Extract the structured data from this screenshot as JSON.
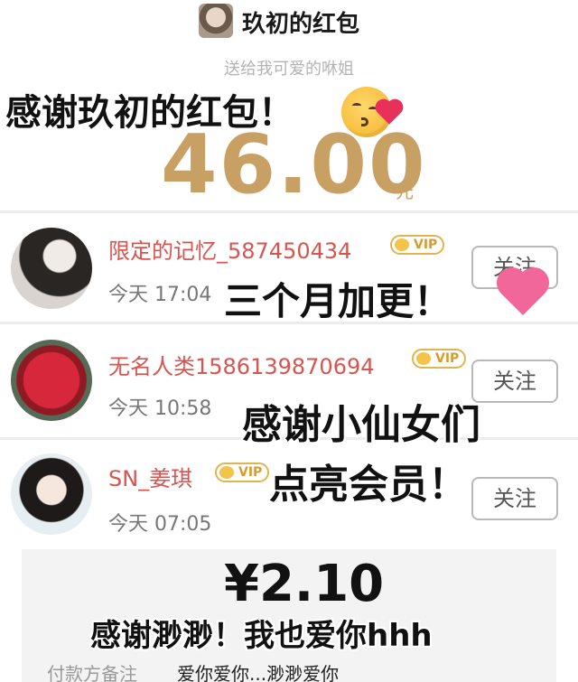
{
  "header": {
    "title": "玖初的红包"
  },
  "subtitle": "送给我可爱的咻姐",
  "amount": {
    "value": "46.00",
    "unit": "元"
  },
  "overlays": [
    "感谢玖初的红包！",
    "三个月加更！",
    "感谢小仙女们",
    "点亮会员！",
    "感谢渺渺！我也爱你hhh"
  ],
  "vip_label": "VIP",
  "follow_label": "关注",
  "senders": [
    {
      "name": "限定的记忆_587450434",
      "time": "今天 17:04"
    },
    {
      "name": "无名人类1586139870694",
      "time": "今天 10:58"
    },
    {
      "name": "SN_姜琪",
      "time": "今天 07:05"
    }
  ],
  "payment": {
    "amount": "¥2.10",
    "remark_label": "付款方备注",
    "remark_value": "爱你爱你...渺渺爱你"
  },
  "colors": {
    "gold": "#c8a063",
    "name_red": "#d9534f",
    "vip_gold": "#e0b450"
  },
  "icons": [
    "kiss-emoji-icon",
    "pink-heart-emoji-icon",
    "crown-icon"
  ]
}
